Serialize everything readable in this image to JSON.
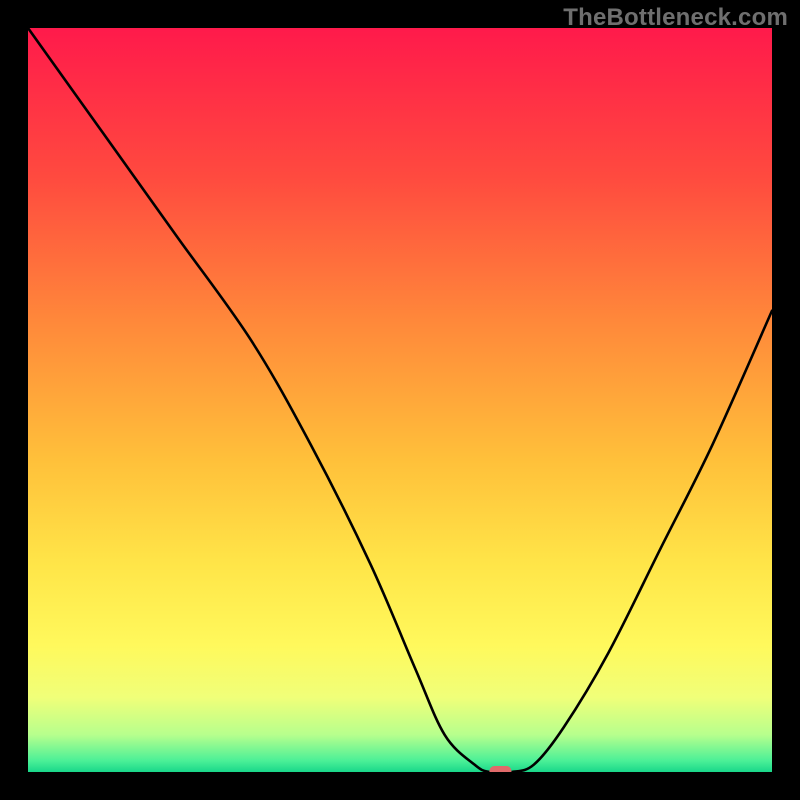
{
  "watermark": "TheBottleneck.com",
  "chart_data": {
    "type": "line",
    "title": "",
    "xlabel": "",
    "ylabel": "",
    "xlim": [
      0,
      100
    ],
    "ylim": [
      0,
      100
    ],
    "x": [
      0,
      10,
      20,
      30,
      38,
      46,
      52,
      56,
      60,
      62,
      65,
      68,
      72,
      78,
      85,
      92,
      100
    ],
    "values": [
      100,
      86,
      72,
      58,
      44,
      28,
      14,
      5,
      1,
      0,
      0,
      1,
      6,
      16,
      30,
      44,
      62
    ],
    "minimum_marker": {
      "x": 63.5,
      "y": 0,
      "color": "#e06a6a"
    },
    "gradient_stops": [
      {
        "pct": 0.0,
        "color": "#ff1a4b"
      },
      {
        "pct": 0.2,
        "color": "#ff4a3f"
      },
      {
        "pct": 0.4,
        "color": "#ff8a3a"
      },
      {
        "pct": 0.58,
        "color": "#ffc03a"
      },
      {
        "pct": 0.72,
        "color": "#ffe548"
      },
      {
        "pct": 0.83,
        "color": "#fff95c"
      },
      {
        "pct": 0.9,
        "color": "#f0ff79"
      },
      {
        "pct": 0.95,
        "color": "#b7ff8d"
      },
      {
        "pct": 0.985,
        "color": "#4bf097"
      },
      {
        "pct": 1.0,
        "color": "#19d78a"
      }
    ]
  }
}
